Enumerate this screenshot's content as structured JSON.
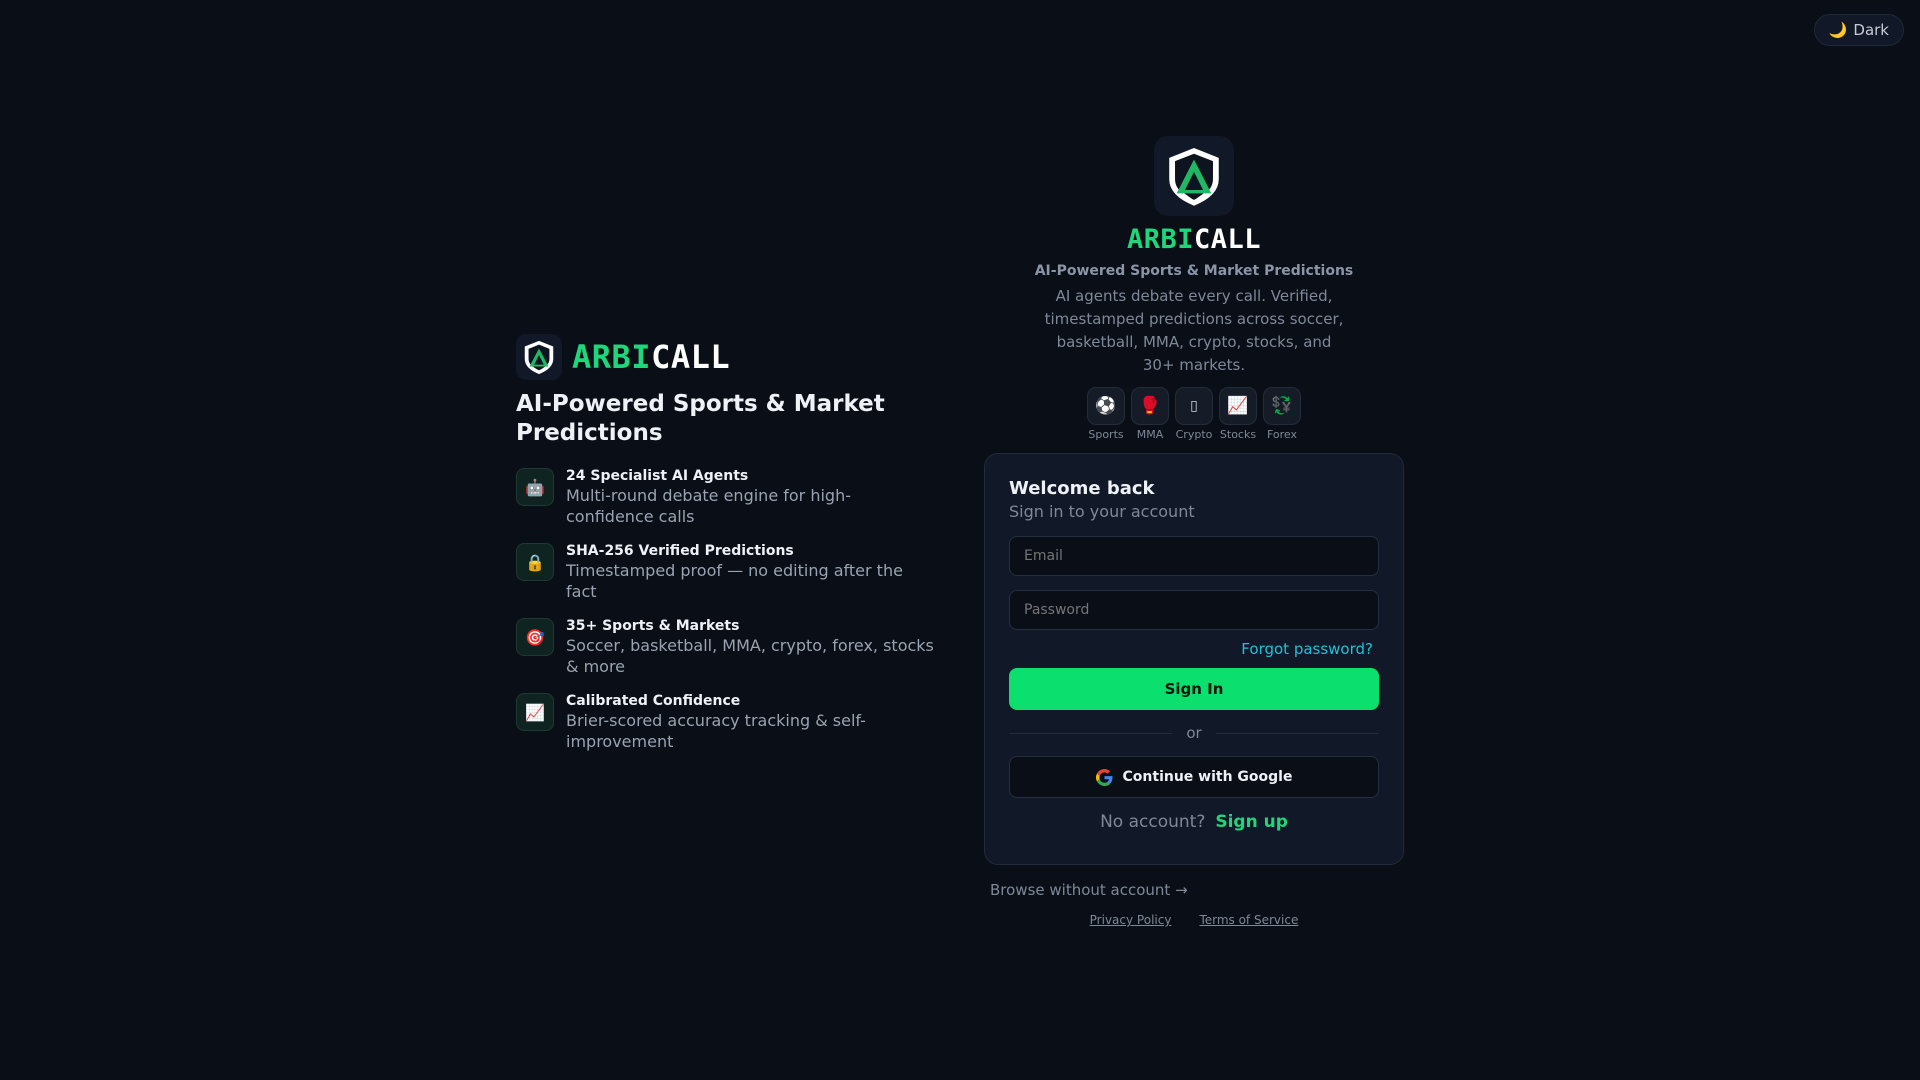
{
  "header": {
    "theme_toggle_icon": "moon-icon",
    "theme_toggle_label": "Dark"
  },
  "brand": {
    "name_part1": "ARBI",
    "name_part2": "CALL",
    "accent": "#1fd67a"
  },
  "left": {
    "headline": "AI-Powered Sports & Market Predictions",
    "features": [
      {
        "icon": "robot-icon",
        "title": "24 Specialist AI Agents",
        "desc": "Multi-round debate engine for high-confidence calls"
      },
      {
        "icon": "lock-icon",
        "title": "SHA-256 Verified Predictions",
        "desc": "Timestamped proof — no editing after the fact"
      },
      {
        "icon": "target-icon",
        "title": "35+ Sports & Markets",
        "desc": "Soccer, basketball, MMA, crypto, forex, stocks & more"
      },
      {
        "icon": "chart-icon",
        "title": "Calibrated Confidence",
        "desc": "Brier-scored accuracy tracking & self-improvement"
      }
    ]
  },
  "right": {
    "tagline": "AI-Powered Sports & Market Predictions",
    "subtitle": "AI agents debate every call. Verified, timestamped predictions across soccer, basketball, MMA, crypto, stocks, and 30+ markets.",
    "markets": [
      {
        "icon": "soccer-ball-icon",
        "label": "Sports"
      },
      {
        "icon": "boxing-glove-icon",
        "label": "MMA"
      },
      {
        "icon": "coin-icon",
        "label": "Crypto"
      },
      {
        "icon": "chart-up-icon",
        "label": "Stocks"
      },
      {
        "icon": "exchange-icon",
        "label": "Forex"
      }
    ]
  },
  "login": {
    "title": "Welcome back",
    "subtitle": "Sign in to your account",
    "email_placeholder": "Email",
    "password_placeholder": "Password",
    "forgot": "Forgot password?",
    "signin_label": "Sign In",
    "divider": "or",
    "google_label": "Continue with Google",
    "no_account": "No account?",
    "signup_label": "Sign up"
  },
  "footer": {
    "browse": "Browse without account →",
    "privacy": "Privacy Policy",
    "terms": "Terms of Service"
  }
}
